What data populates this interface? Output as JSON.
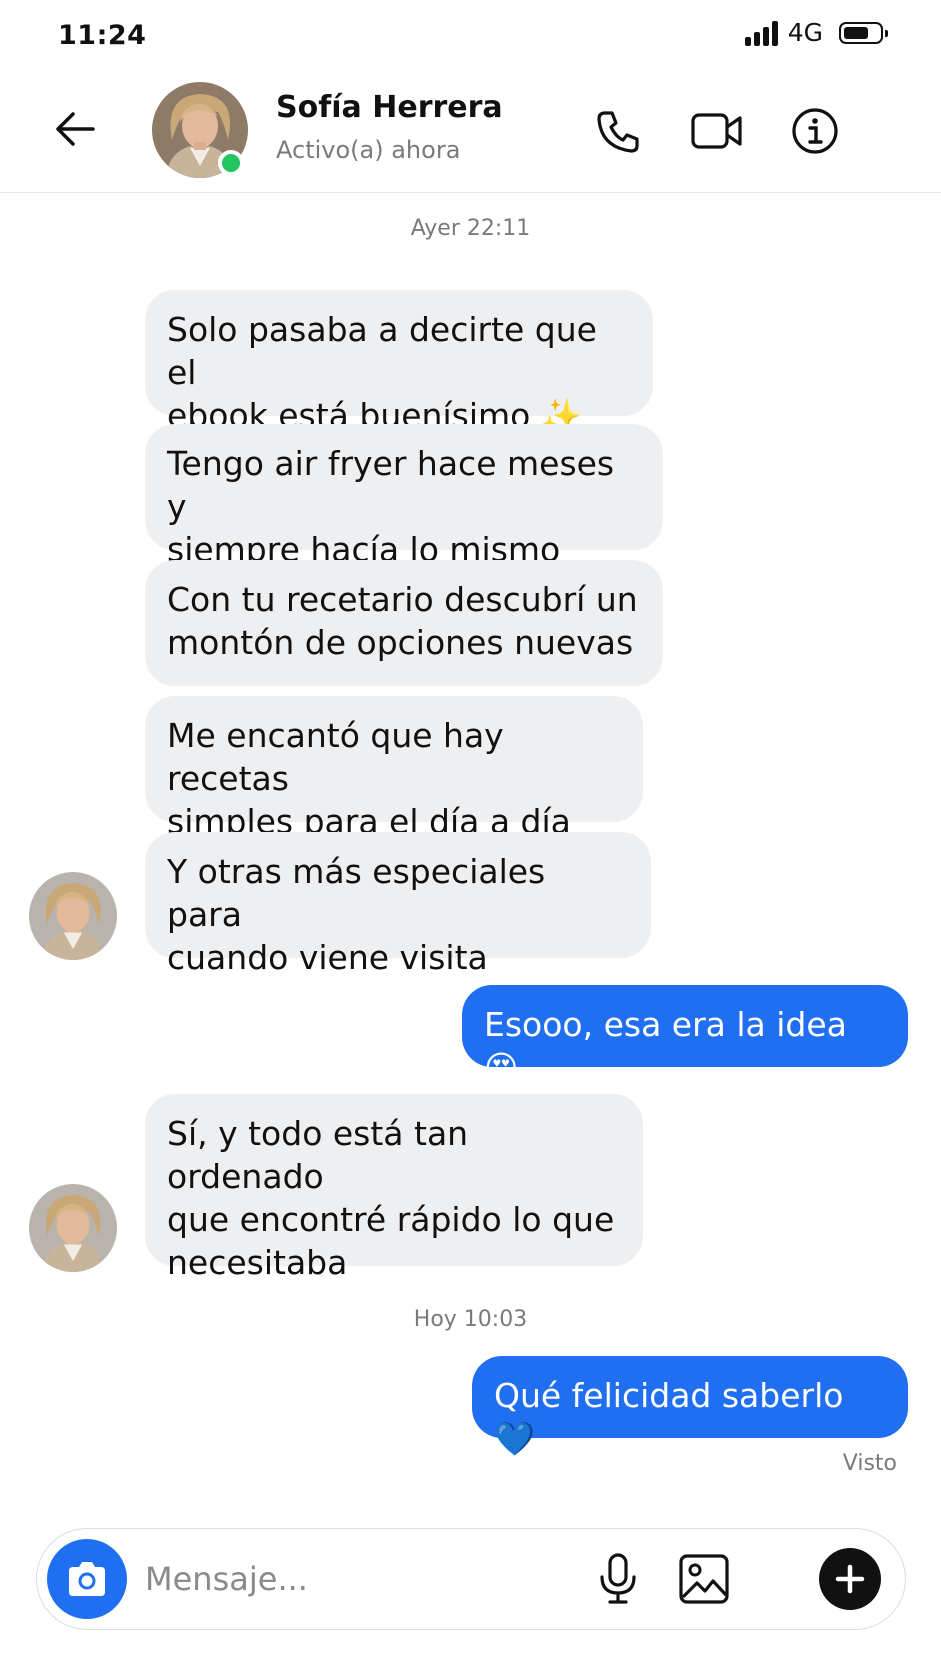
{
  "status_bar": {
    "time": "11:24",
    "network": "4G"
  },
  "header": {
    "contact_name": "Sofía Herrera",
    "contact_status": "Activo(a) ahora",
    "online_color": "#23c55e",
    "icons": [
      "back-arrow-icon",
      "phone-icon",
      "video-camera-icon",
      "info-icon"
    ]
  },
  "chat": {
    "timestamp_1": "Ayer 22:11",
    "incoming_group_1": [
      "Solo pasaba a decirte que el\nebook está buenísimo ✨",
      "Tengo air fryer hace meses y\nsiempre hacía lo mismo",
      "Con tu recetario descubrí un\nmontón de opciones nuevas",
      "Me encantó que hay recetas\nsimples para el día a día",
      "Y otras más especiales para\ncuando viene visita"
    ],
    "outgoing_1": "Esooo, esa era la idea 😍",
    "incoming_2": "Sí, y todo está tan ordenado\nque encontré rápido lo que\nnecesitaba",
    "timestamp_2": "Hoy 10:03",
    "outgoing_2": "Qué felicidad saberlo 💙",
    "seen_label": "Visto"
  },
  "composer": {
    "placeholder": "Mensaje...",
    "icons": [
      "camera-icon",
      "microphone-icon",
      "image-icon",
      "plus-icon"
    ]
  },
  "colors": {
    "accent": "#1f6ff0",
    "incoming_bubble": "#eeeff1",
    "muted_text": "#7a7a7a"
  }
}
